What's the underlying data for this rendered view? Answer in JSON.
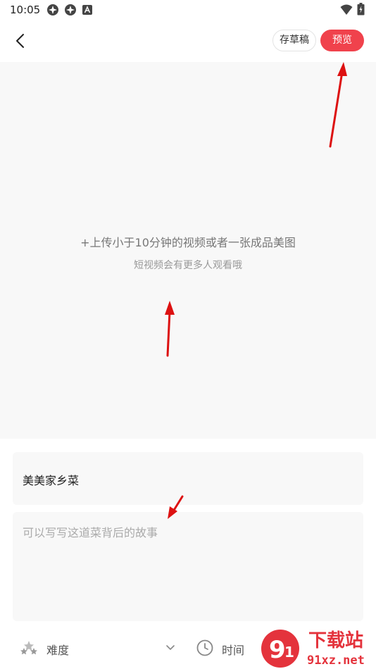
{
  "status_bar": {
    "time": "10:05",
    "icons": [
      "app-notification-icon",
      "app-notification-icon",
      "a-icon",
      "wifi-icon",
      "battery-icon"
    ]
  },
  "header": {
    "back_icon": "chevron-left-icon",
    "draft_label": "存草稿",
    "preview_label": "预览"
  },
  "upload": {
    "main_text": "+上传小于10分钟的视频或者一张成品美图",
    "sub_text": "短视频会有更多人观看哦"
  },
  "form": {
    "title_value": "美美家乡菜",
    "story_placeholder": "可以写写这道菜背后的故事"
  },
  "bottom": {
    "difficulty_label": "难度",
    "time_label": "时间"
  },
  "watermark": {
    "text": "下载站",
    "url": "91xz.net"
  },
  "colors": {
    "accent": "#f0424c",
    "annotation_arrow": "#dd1111",
    "surface": "#f8f8f8"
  }
}
